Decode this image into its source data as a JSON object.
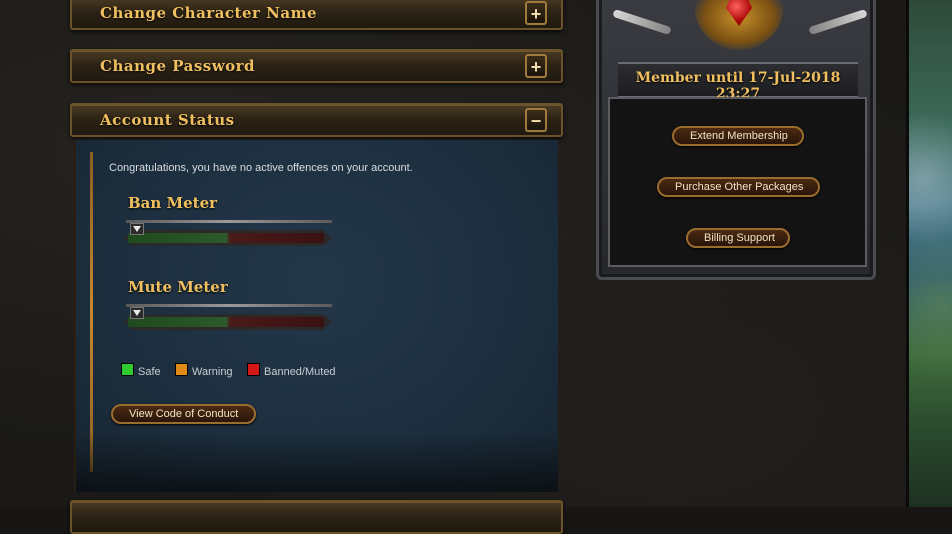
{
  "accordion": {
    "items": [
      {
        "title": "Change Character Name",
        "toggle": "+"
      },
      {
        "title": "Change Password",
        "toggle": "+"
      },
      {
        "title": "Account Status",
        "toggle": "−"
      }
    ]
  },
  "account_status": {
    "message": "Congratulations, you have no active offences on your account.",
    "ban_meter_title": "Ban Meter",
    "mute_meter_title": "Mute Meter",
    "ban_level": 0,
    "mute_level": 0,
    "legend": {
      "safe": "Safe",
      "warning": "Warning",
      "banned": "Banned/Muted"
    },
    "conduct_button": "View Code of Conduct"
  },
  "membership": {
    "until_text": "Member until 17-Jul-2018 23:27",
    "extend_button": "Extend Membership",
    "purchase_button": "Purchase Other Packages",
    "billing_button": "Billing Support"
  },
  "colors": {
    "accent_gold": "#f0c060",
    "safe": "#2ecc2e",
    "warning": "#e08a1a",
    "banned": "#d41818"
  }
}
